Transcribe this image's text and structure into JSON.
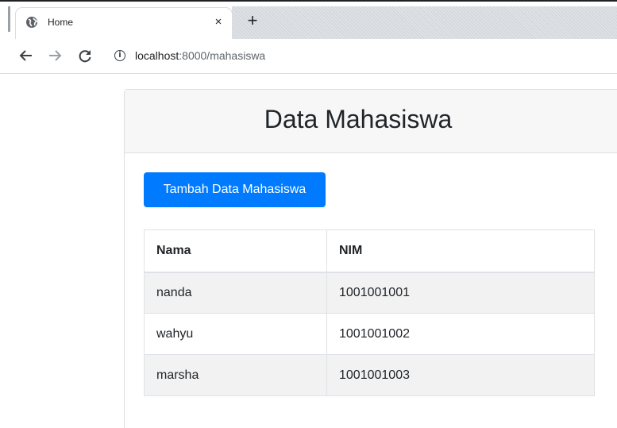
{
  "browser": {
    "tab_title": "Home",
    "tab_close": "×",
    "new_tab": "+",
    "url_host": "localhost",
    "url_path": ":8000/mahasiswa",
    "icons": {
      "favicon": "globe-icon",
      "back": "arrow-left-icon",
      "forward": "arrow-right-icon",
      "reload": "reload-icon",
      "info": "info-icon"
    }
  },
  "page": {
    "title": "Data Mahasiswa",
    "add_button_label": "Tambah Data Mahasiswa",
    "table": {
      "headers": [
        "Nama",
        "NIM"
      ],
      "rows": [
        [
          "nanda",
          "1001001001"
        ],
        [
          "wahyu",
          "1001001002"
        ],
        [
          "marsha",
          "1001001003"
        ]
      ]
    }
  },
  "colors": {
    "primary": "#007bff",
    "header_bg": "#f7f7f7",
    "striped_row": "#f2f2f2"
  }
}
